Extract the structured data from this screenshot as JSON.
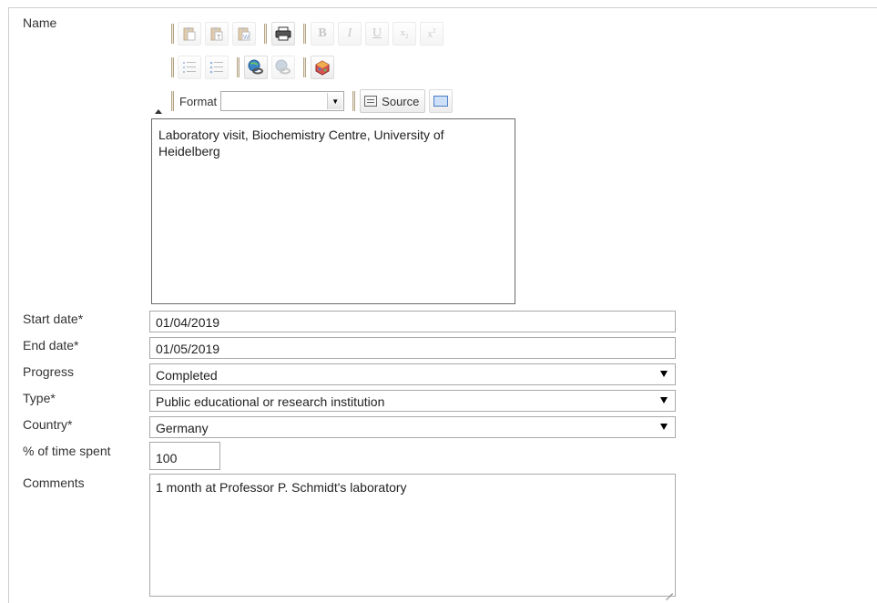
{
  "labels": {
    "name": "Name",
    "start_date": "Start date*",
    "end_date": "End date*",
    "progress": "Progress",
    "type": "Type*",
    "country": "Country*",
    "time_spent": "% of time spent",
    "comments": "Comments"
  },
  "editor": {
    "toolbar": {
      "row1": [
        "paste-icon",
        "paste-text-icon",
        "paste-word-icon",
        "print-icon",
        "bold-icon",
        "italic-icon",
        "underline-icon",
        "subscript-icon",
        "superscript-icon"
      ],
      "bold": "B",
      "italic": "I",
      "underline": "U",
      "row2": [
        "numbered-list-icon",
        "bulleted-list-icon",
        "link-icon",
        "unlink-icon",
        "image-icon"
      ],
      "format_label": "Format",
      "format_value": "",
      "source_label": "Source"
    },
    "content": "Laboratory visit, Biochemistry Centre, University of Heidelberg"
  },
  "fields": {
    "start_date": "01/04/2019",
    "end_date": "01/05/2019",
    "progress": "Completed",
    "type": "Public educational or research institution",
    "country": "Germany",
    "time_spent": "100",
    "comments": "1 month at Professor P. Schmidt's laboratory"
  }
}
